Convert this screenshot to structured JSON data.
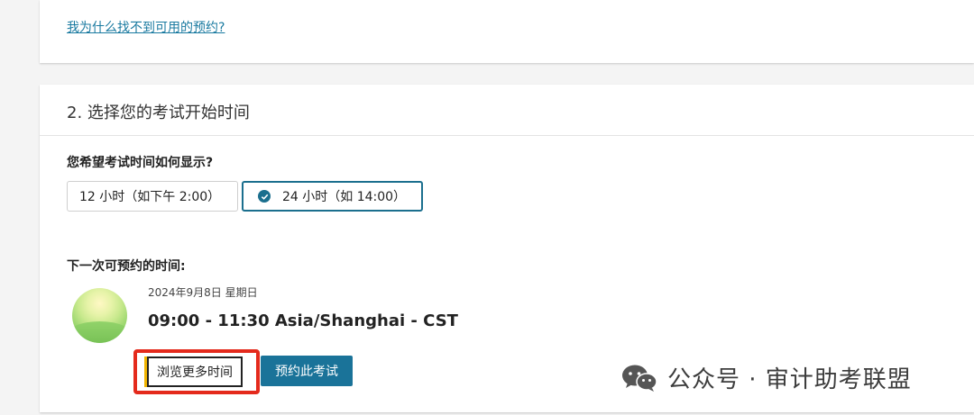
{
  "top_card": {
    "link_text": "我为什么找不到可用的预约?"
  },
  "section": {
    "title": "2. 选择您的考试开始时间",
    "question": "您希望考试时间如何显示?",
    "options": [
      {
        "label": "12 小时（如下午 2:00）",
        "selected": false
      },
      {
        "label": "24 小时（如 14:00）",
        "selected": true
      }
    ]
  },
  "next": {
    "label": "下一次可预约的时间:",
    "date": "2024年9月8日 星期日",
    "time": "09:00 - 11:30 Asia/Shanghai - CST"
  },
  "buttons": {
    "browse": "浏览更多时间",
    "book": "预约此考试"
  },
  "colors": {
    "accent": "#1a7399",
    "highlight": "#e42a1c",
    "link": "#1a7aa0"
  },
  "watermark": {
    "text": "公众号 · 审计助考联盟",
    "icon": "wechat-icon"
  }
}
